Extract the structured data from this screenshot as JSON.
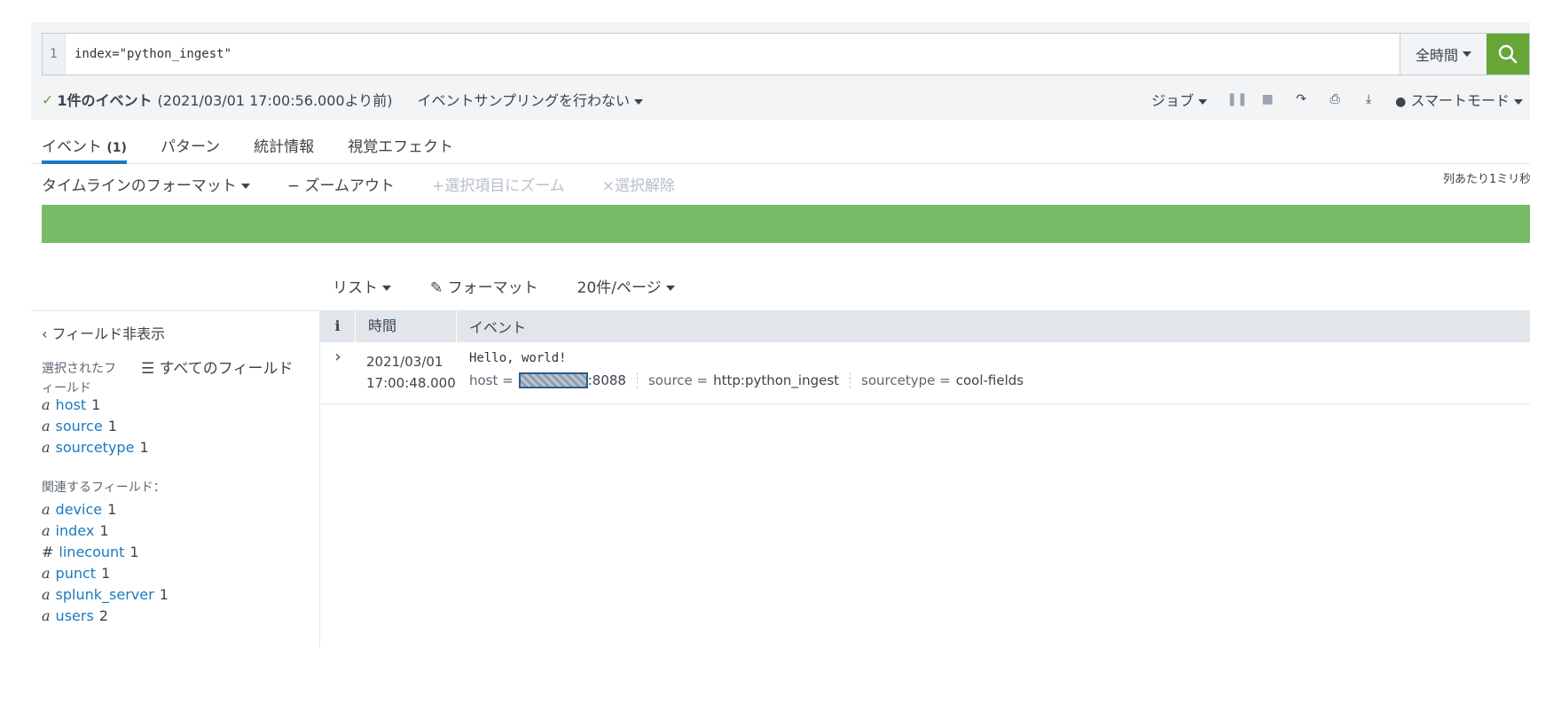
{
  "search": {
    "line_number": "1",
    "query": "index=\"python_ingest\"",
    "time_range": "全時間"
  },
  "status": {
    "check": "✓",
    "count": "1件のイベント",
    "date_range": "(2021/03/01 17:00:56.000より前)",
    "sampling": "イベントサンプリングを行わない",
    "job": "ジョブ",
    "mode": "スマートモード"
  },
  "tabs": [
    {
      "label": "イベント",
      "count": "(1)"
    },
    {
      "label": "パターン"
    },
    {
      "label": "統計情報"
    },
    {
      "label": "視覚エフェクト"
    }
  ],
  "timeline": {
    "format": "タイムラインのフォーマット",
    "zoom_out": "ズームアウト",
    "zoom_selection": "選択項目にズーム",
    "deselect": "選択解除",
    "scale": "列あたり1ミリ秒"
  },
  "results": {
    "list": "リスト",
    "format": "フォーマット",
    "per_page": "20件/ページ"
  },
  "sidebar": {
    "hide_fields": "フィールド非表示",
    "selected_label": "選択されたフィールド",
    "all_fields": "すべてのフィールド",
    "selected_fields": [
      {
        "type": "a",
        "name": "host",
        "count": "1"
      },
      {
        "type": "a",
        "name": "source",
        "count": "1"
      },
      {
        "type": "a",
        "name": "sourcetype",
        "count": "1"
      }
    ],
    "related_label": "関連するフィールド：",
    "related_fields": [
      {
        "type": "a",
        "name": "device",
        "count": "1"
      },
      {
        "type": "a",
        "name": "index",
        "count": "1"
      },
      {
        "type": "#",
        "name": "linecount",
        "count": "1"
      },
      {
        "type": "a",
        "name": "punct",
        "count": "1"
      },
      {
        "type": "a",
        "name": "splunk_server",
        "count": "1"
      },
      {
        "type": "a",
        "name": "users",
        "count": "2"
      }
    ]
  },
  "table": {
    "col_info": "i",
    "col_time": "時間",
    "col_event": "イベント",
    "rows": [
      {
        "date": "2021/03/01",
        "time": "17:00:48.000",
        "raw": "Hello, world!",
        "host_key": "host =",
        "host_suffix": ":8088",
        "source_key": "source =",
        "source_val": "http:python_ingest",
        "sourcetype_key": "sourcetype =",
        "sourcetype_val": "cool-fields"
      }
    ]
  },
  "colors": {
    "accent": "#65a637",
    "link": "#1a7ac0",
    "timeline": "#77bb66"
  }
}
